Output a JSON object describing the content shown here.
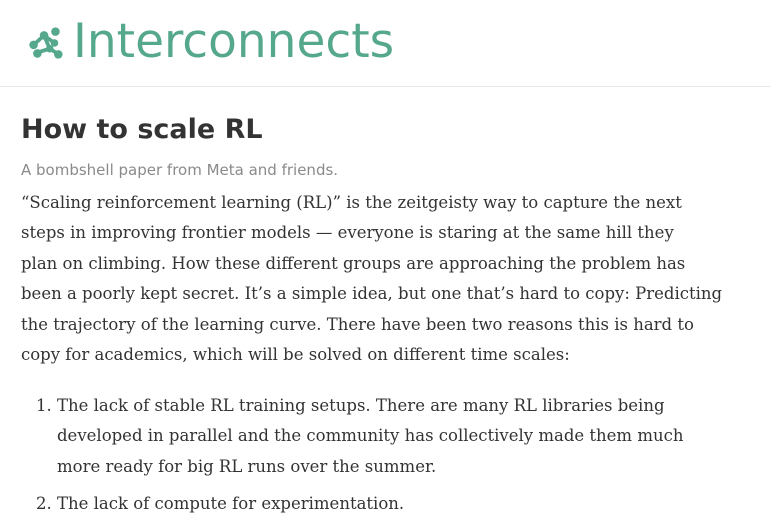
{
  "header": {
    "site_name": "Interconnects",
    "logo_icon": "interconnects-logo-icon",
    "brand_color": "#55a88c"
  },
  "post": {
    "title": "How to scale RL",
    "subtitle": "A bombshell paper from Meta and friends.",
    "body_lines": [
      "“Scaling reinforcement learning (RL)” is the zeitgeisty way to capture the next",
      "steps in improving frontier models — everyone is staring at the same hill they",
      "plan on climbing. How these different groups are approaching the problem has",
      "been a poorly kept secret. It’s a simple idea, but one that’s hard to copy: Predicting",
      "the trajectory of the learning curve. There have been two reasons this is hard to",
      "copy for academics, which will be solved on different time scales:"
    ],
    "list": [
      {
        "number": "1.",
        "lines": [
          "The lack of stable RL training setups. There are many RL libraries being",
          "developed in parallel and the community has collectively made them much",
          "more ready for big RL runs over the summer."
        ]
      },
      {
        "number": "2.",
        "lines": [
          "The lack of compute for experimentation."
        ]
      }
    ]
  }
}
